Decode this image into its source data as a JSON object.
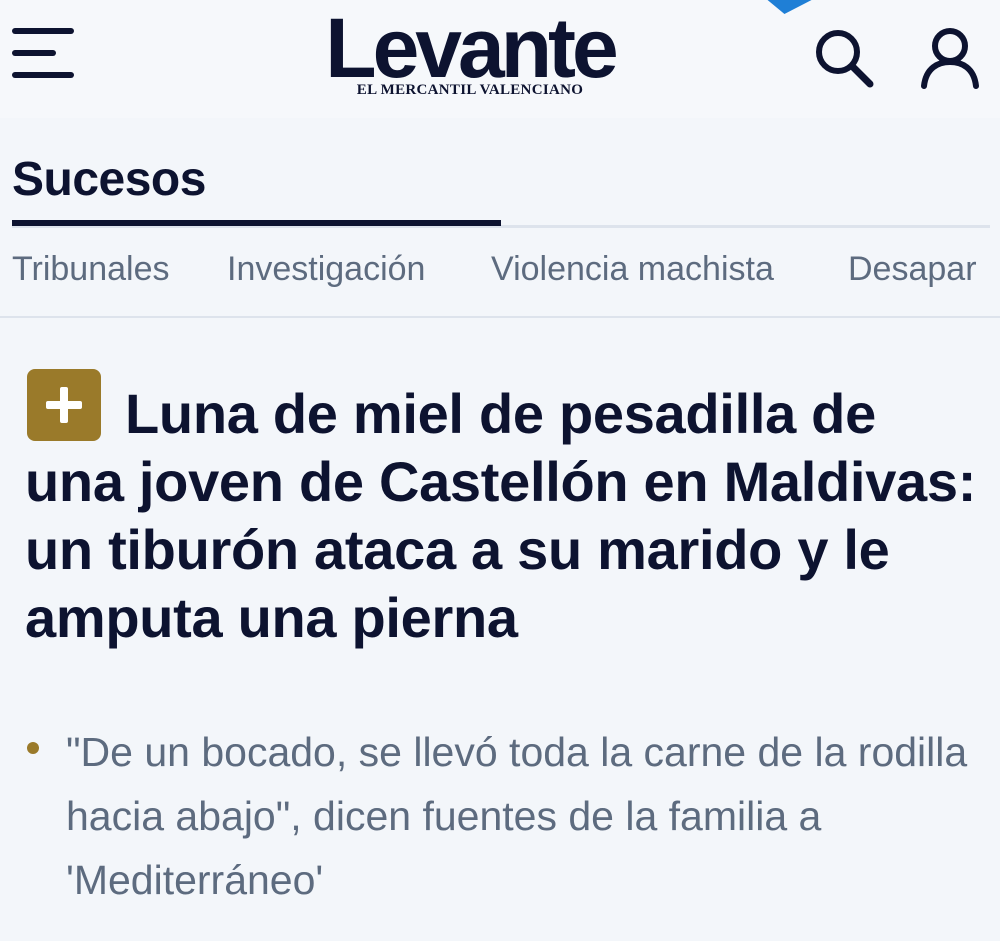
{
  "header": {
    "logo_title": "Levante",
    "logo_subtitle": "EL MERCANTIL VALENCIANO",
    "icons": {
      "menu": "hamburger-menu-icon",
      "search": "search-icon",
      "user": "user-icon"
    },
    "accent_color": "#1f7fd6"
  },
  "section": {
    "title": "Sucesos"
  },
  "subnav": {
    "items": [
      "Tribunales",
      "Investigación",
      "Violencia machista",
      "Desapar"
    ]
  },
  "article": {
    "badge_icon": "plus-icon",
    "badge_color": "#9a7a2a",
    "headline": "Luna de miel de pesadilla de una joven de Castellón en Maldivas: un tiburón ataca a su marido y le amputa una pierna",
    "summary": "\"De un bocado, se llevó toda la carne de la rodilla hacia abajo\", dicen fuentes de la familia a 'Mediterráneo'"
  }
}
